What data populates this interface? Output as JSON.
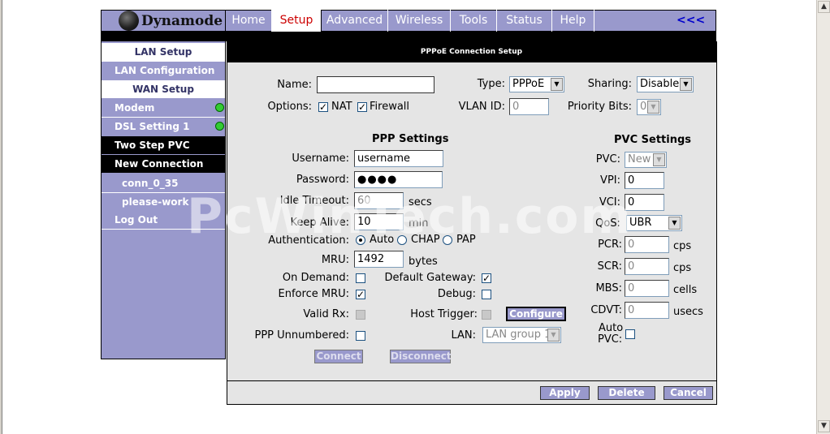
{
  "brand": {
    "name": "Dynamode",
    "accent": "#9999cc"
  },
  "nav": {
    "tabs": [
      {
        "label": "Home"
      },
      {
        "label": "Setup",
        "active": true
      },
      {
        "label": "Advanced"
      },
      {
        "label": "Wireless"
      },
      {
        "label": "Tools"
      },
      {
        "label": "Status"
      },
      {
        "label": "Help"
      }
    ],
    "back": "<<<"
  },
  "sidebar": {
    "lan_setup": "LAN Setup",
    "lan_configuration": "LAN Configuration",
    "wan_setup": "WAN Setup",
    "modem": "Modem",
    "dsl_setting": "DSL Setting 1",
    "two_step_pvc": "Two Step PVC",
    "new_connection": "New Connection",
    "conn": "conn_0_35",
    "please_work": "please-work",
    "logout": "Log Out"
  },
  "page": {
    "title": "PPPoE Connection Setup"
  },
  "form": {
    "name_label": "Name:",
    "name_value": "",
    "type_label": "Type:",
    "type_value": "PPPoE",
    "sharing_label": "Sharing:",
    "sharing_value": "Disable",
    "options_label": "Options:",
    "nat_label": "NAT",
    "firewall_label": "Firewall",
    "vlan_label": "VLAN ID:",
    "vlan_value": "0",
    "priority_label": "Priority Bits:",
    "priority_value": "0",
    "ppp_heading": "PPP Settings",
    "username_label": "Username:",
    "username_value": "username",
    "password_label": "Password:",
    "password_value": "●●●●",
    "idle_label": "Idle Timeout:",
    "idle_value": "60",
    "idle_unit": "secs",
    "keepalive_label": "Keep Alive:",
    "keepalive_value": "10",
    "keepalive_unit": "min",
    "auth_label": "Authentication:",
    "auth_auto": "Auto",
    "auth_chap": "CHAP",
    "auth_pap": "PAP",
    "mru_label": "MRU:",
    "mru_value": "1492",
    "mru_unit": "bytes",
    "on_demand_label": "On Demand:",
    "default_gw_label": "Default Gateway:",
    "enforce_mru_label": "Enforce MRU:",
    "debug_label": "Debug:",
    "valid_rx_label": "Valid Rx:",
    "host_trigger_label": "Host Trigger:",
    "configure_btn": "Configure",
    "ppp_unnumbered_label": "PPP Unnumbered:",
    "lan_label": "LAN:",
    "lan_value": "LAN group 1",
    "connect_btn": "Connect",
    "disconnect_btn": "Disconnect",
    "pvc_heading": "PVC Settings",
    "pvc_label": "PVC:",
    "pvc_value": "New",
    "vpi_label": "VPI:",
    "vpi_value": "0",
    "vci_label": "VCI:",
    "vci_value": "0",
    "qos_label": "QoS:",
    "qos_value": "UBR",
    "pcr_label": "PCR:",
    "pcr_value": "0",
    "pcr_unit": "cps",
    "scr_label": "SCR:",
    "scr_value": "0",
    "scr_unit": "cps",
    "mbs_label": "MBS:",
    "mbs_value": "0",
    "mbs_unit": "cells",
    "cdvt_label": "CDVT:",
    "cdvt_value": "0",
    "cdvt_unit": "usecs",
    "autopvc_label1": "Auto",
    "autopvc_label2": "PVC:"
  },
  "footer": {
    "apply": "Apply",
    "delete": "Delete",
    "cancel": "Cancel"
  },
  "watermark": "PcWinTech.com"
}
